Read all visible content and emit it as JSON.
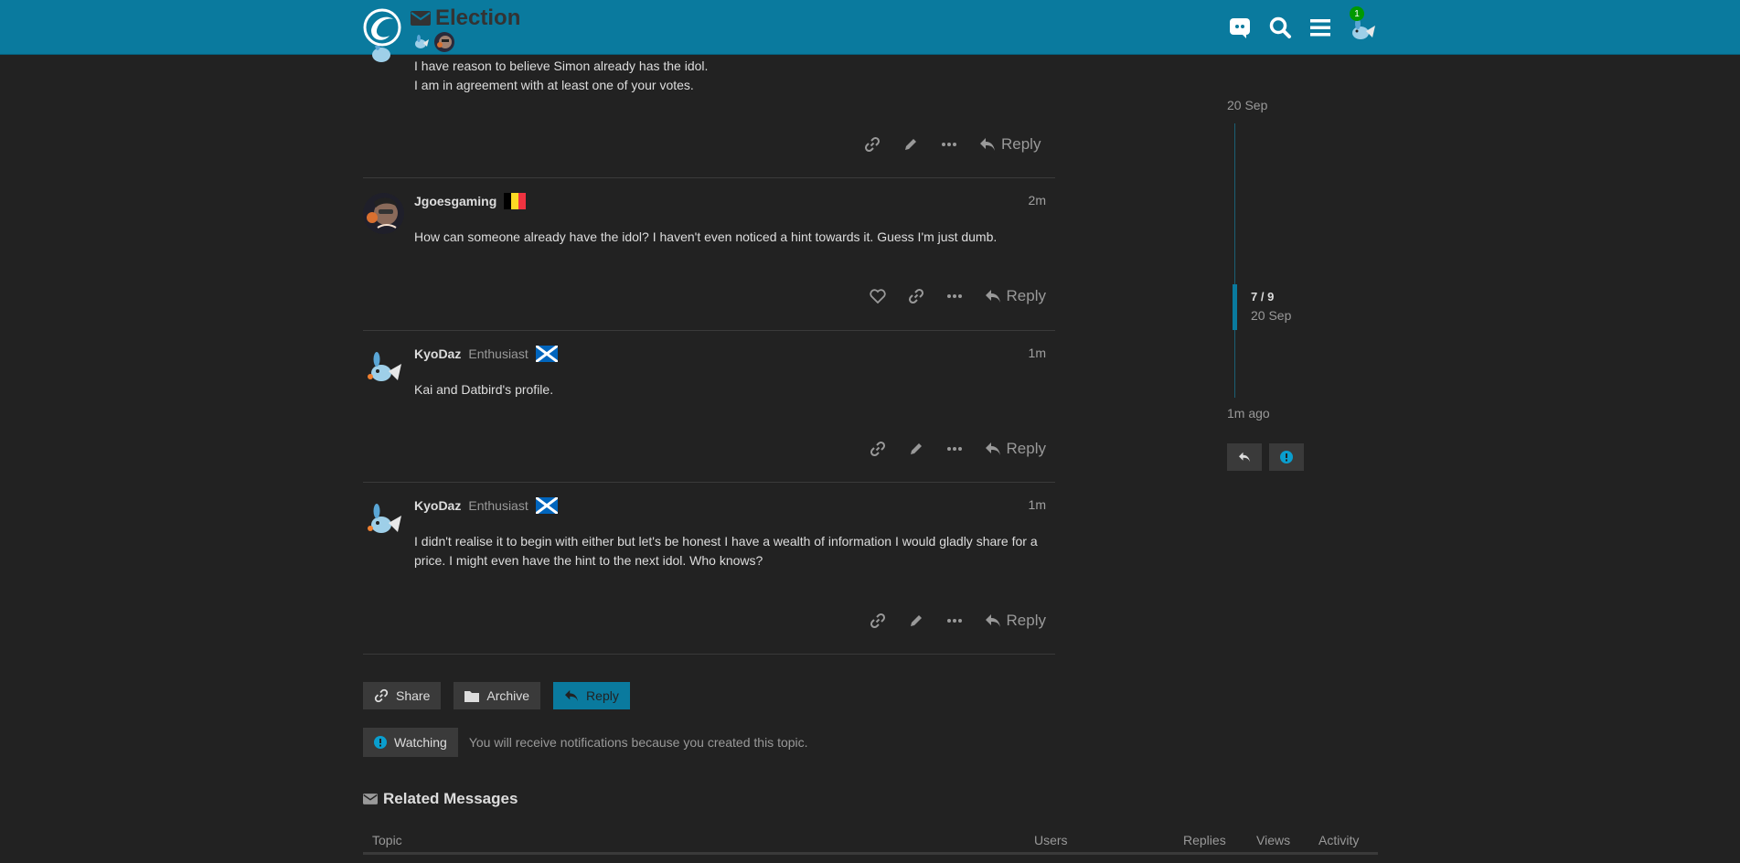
{
  "header": {
    "title": "Election",
    "notification_count": "1"
  },
  "partial_post": {
    "lines": [
      "I have reason to believe Simon already has the idol.",
      "I am in agreement with at least one of your votes."
    ],
    "reply_label": "Reply"
  },
  "posts": [
    {
      "username": "Jgoesgaming",
      "user_title": "",
      "flag": "belgium-flag",
      "date": "2m",
      "text": "How can someone already have the idol? I haven't even noticed a hint towards it. Guess I'm just dumb.",
      "reply_label": "Reply"
    },
    {
      "username": "KyoDaz",
      "user_title": "Enthusiast",
      "flag": "scotland-flag",
      "date": "1m",
      "text": "Kai and Datbird's profile.",
      "reply_label": "Reply"
    },
    {
      "username": "KyoDaz",
      "user_title": "Enthusiast",
      "flag": "scotland-flag",
      "date": "1m",
      "text": "I didn't realise it to begin with either but let's be honest I have a wealth of information I would gladly share for a price. I might even have the hint to the next idol. Who knows?",
      "reply_label": "Reply"
    }
  ],
  "footer": {
    "share_label": "Share",
    "archive_label": "Archive",
    "reply_label": "Reply",
    "watching_label": "Watching",
    "watching_desc": "You will receive notifications because you created this topic."
  },
  "related": {
    "title": "Related Messages",
    "columns": [
      "Topic",
      "Users",
      "Replies",
      "Views",
      "Activity"
    ]
  },
  "timeline": {
    "top_date": "20 Sep",
    "position": "7 / 9",
    "position_date": "20 Sep",
    "bottom_date": "1m ago"
  },
  "colors": {
    "header_bg": "#0a7a9e",
    "page_bg": "#222222",
    "accent": "#0a7a9e"
  }
}
